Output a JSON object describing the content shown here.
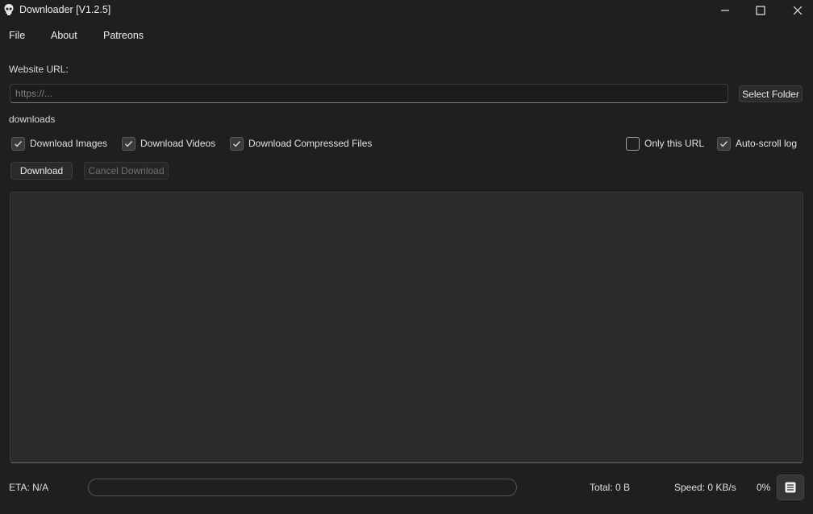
{
  "window": {
    "title": "Downloader [V1.2.5]",
    "icon": "skull-icon"
  },
  "menu": {
    "items": [
      "File",
      "About",
      "Patreons"
    ]
  },
  "form": {
    "url_label": "Website URL:",
    "url_placeholder": "https://...",
    "url_value": "",
    "select_folder_label": "Select Folder",
    "folder_path": "downloads"
  },
  "options": {
    "download_images": {
      "label": "Download Images",
      "checked": true
    },
    "download_videos": {
      "label": "Download Videos",
      "checked": true
    },
    "download_compressed": {
      "label": "Download Compressed Files",
      "checked": true
    },
    "only_this_url": {
      "label": "Only this URL",
      "checked": false
    },
    "auto_scroll_log": {
      "label": "Auto-scroll log",
      "checked": true
    }
  },
  "actions": {
    "download_label": "Download",
    "cancel_label": "Cancel Download"
  },
  "log": {
    "lines": []
  },
  "status": {
    "eta": "ETA: N/A",
    "total": "Total: 0 B",
    "speed": "Speed: 0 KB/s",
    "percent_text": "0%",
    "progress_fraction": 0
  },
  "colors": {
    "background": "#1f1f1f",
    "accent": "#4c8bd4"
  }
}
